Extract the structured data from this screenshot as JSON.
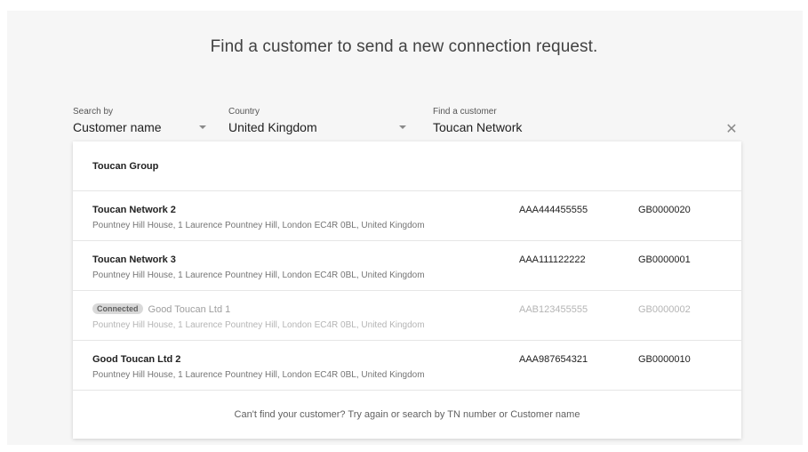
{
  "heading": "Find a customer to send a new connection request.",
  "filters": {
    "search_by": {
      "label": "Search by",
      "value": "Customer name"
    },
    "country": {
      "label": "Country",
      "value": "United Kingdom"
    },
    "find": {
      "label": "Find a customer",
      "value": "Toucan Network",
      "clear_icon": "close-icon"
    }
  },
  "results": [
    {
      "name": "Toucan Group",
      "address": "",
      "code": "",
      "tn": "",
      "connected": false
    },
    {
      "name": "Toucan Network 2",
      "address": "Pountney Hill House, 1 Laurence Pountney Hill, London EC4R 0BL, United Kingdom",
      "code": "AAA444455555",
      "tn": "GB0000020",
      "connected": false
    },
    {
      "name": "Toucan Network 3",
      "address": "Pountney Hill House, 1 Laurence Pountney Hill, London EC4R 0BL, United Kingdom",
      "code": "AAA111122222",
      "tn": "GB0000001",
      "connected": false
    },
    {
      "name": "Good Toucan Ltd 1",
      "address": "Pountney Hill House, 1 Laurence Pountney Hill, London EC4R 0BL, United Kingdom",
      "code": "AAB123455555",
      "tn": "GB0000002",
      "connected": true,
      "badge": "Connected"
    },
    {
      "name": "Good Toucan Ltd 2",
      "address": "Pountney Hill House, 1 Laurence Pountney Hill, London EC4R 0BL, United Kingdom",
      "code": "AAA987654321",
      "tn": "GB0000010",
      "connected": false
    }
  ],
  "footer_note": "Can't find your customer? Try again or search by TN number or Customer name"
}
